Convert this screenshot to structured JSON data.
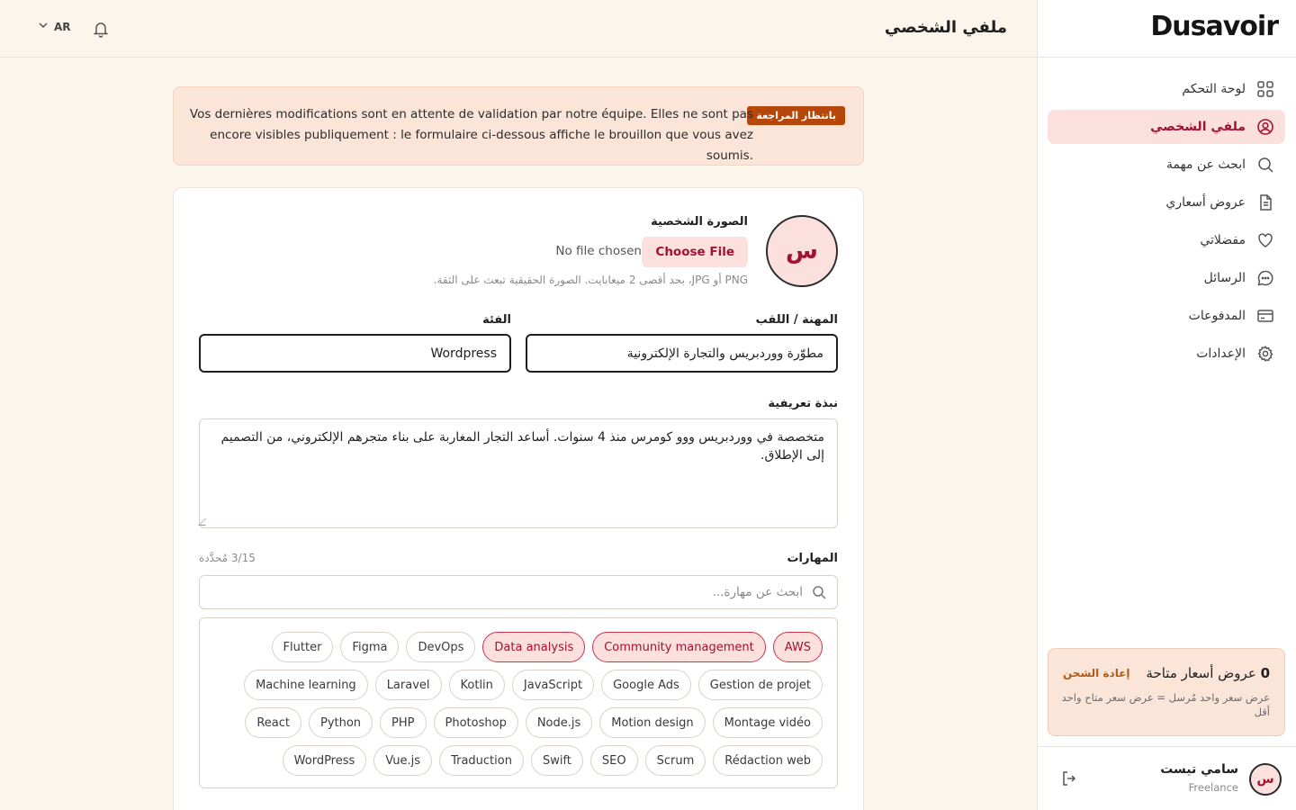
{
  "brand": {
    "name": "Dusavoir"
  },
  "sidebar": {
    "items": [
      {
        "label": "لوحة التحكم",
        "icon": "grid-icon",
        "active": false
      },
      {
        "label": "ملفي الشخصي",
        "icon": "user-circle-icon",
        "active": true
      },
      {
        "label": "ابحث عن مهمة",
        "icon": "search-icon",
        "active": false
      },
      {
        "label": "عروض أسعاري",
        "icon": "document-icon",
        "active": false
      },
      {
        "label": "مفضلاتي",
        "icon": "heart-icon",
        "active": false
      },
      {
        "label": "الرسائل",
        "icon": "chat-icon",
        "active": false
      },
      {
        "label": "المدفوعات",
        "icon": "credit-card-icon",
        "active": false
      },
      {
        "label": "الإعدادات",
        "icon": "gear-icon",
        "active": false
      }
    ],
    "credits": {
      "count": "0",
      "title": "عروض أسعار متاحة",
      "recharge": "إعادة الشحن",
      "note": "عرض سعر واحد مُرسل = عرض سعر متاح واحد أقل"
    },
    "user": {
      "initial": "س",
      "name": "سامي تيست",
      "role": "Freelance"
    }
  },
  "header": {
    "title": "ملفي الشخصي",
    "lang": "AR"
  },
  "banner": {
    "badge": "بانتظار المراجعة",
    "text": "Vos dernières modifications sont en attente de validation par notre équipe. Elles ne sont pas encore visibles publiquement : le formulaire ci-dessous affiche le brouillon que vous avez soumis."
  },
  "form": {
    "photo": {
      "initial": "س",
      "label": "الصورة الشخصية",
      "choose": "Choose File",
      "no_file": "No file chosen",
      "hint": "PNG أو JPG، بحد أقصى 2 ميغابايت. الصورة الحقيقية تبعث على الثقة."
    },
    "job": {
      "label": "المهنة / اللقب",
      "value": "مطوّرة ووردبريس والتجارة الإلكترونية"
    },
    "category": {
      "label": "الفئة",
      "value": "Wordpress"
    },
    "bio": {
      "label": "نبذة تعريفية",
      "value": "متخصصة في ووردبريس ووو كومرس منذ 4 سنوات. أساعد التجار المغاربة على بناء متجرهم الإلكتروني، من التصميم إلى الإطلاق."
    },
    "skills": {
      "label": "المهارات",
      "count": "3/15 مُحدَّدة",
      "search_placeholder": "ابحث عن مهارة...",
      "rows": [
        [
          {
            "name": "AWS",
            "selected": true
          },
          {
            "name": "Community management",
            "selected": true
          },
          {
            "name": "Data analysis",
            "selected": true
          },
          {
            "name": "DevOps",
            "selected": false
          },
          {
            "name": "Figma",
            "selected": false
          },
          {
            "name": "Flutter",
            "selected": false
          }
        ],
        [
          {
            "name": "Gestion de projet",
            "selected": false
          },
          {
            "name": "Google Ads",
            "selected": false
          },
          {
            "name": "JavaScript",
            "selected": false
          },
          {
            "name": "Kotlin",
            "selected": false
          },
          {
            "name": "Laravel",
            "selected": false
          },
          {
            "name": "Machine learning",
            "selected": false
          }
        ],
        [
          {
            "name": "Montage vidéo",
            "selected": false
          },
          {
            "name": "Motion design",
            "selected": false
          },
          {
            "name": "Node.js",
            "selected": false
          },
          {
            "name": "Photoshop",
            "selected": false
          },
          {
            "name": "PHP",
            "selected": false
          },
          {
            "name": "Python",
            "selected": false
          },
          {
            "name": "React",
            "selected": false
          }
        ],
        [
          {
            "name": "Rédaction web",
            "selected": false
          },
          {
            "name": "Scrum",
            "selected": false
          },
          {
            "name": "SEO",
            "selected": false
          },
          {
            "name": "Swift",
            "selected": false
          },
          {
            "name": "Traduction",
            "selected": false
          },
          {
            "name": "Vue.js",
            "selected": false
          },
          {
            "name": "WordPress",
            "selected": false
          }
        ]
      ]
    }
  },
  "colors": {
    "accent": "#a31233",
    "accent_bg": "#fbe0dd",
    "badge": "#b5470b",
    "page_bg": "#fbf5ec"
  }
}
